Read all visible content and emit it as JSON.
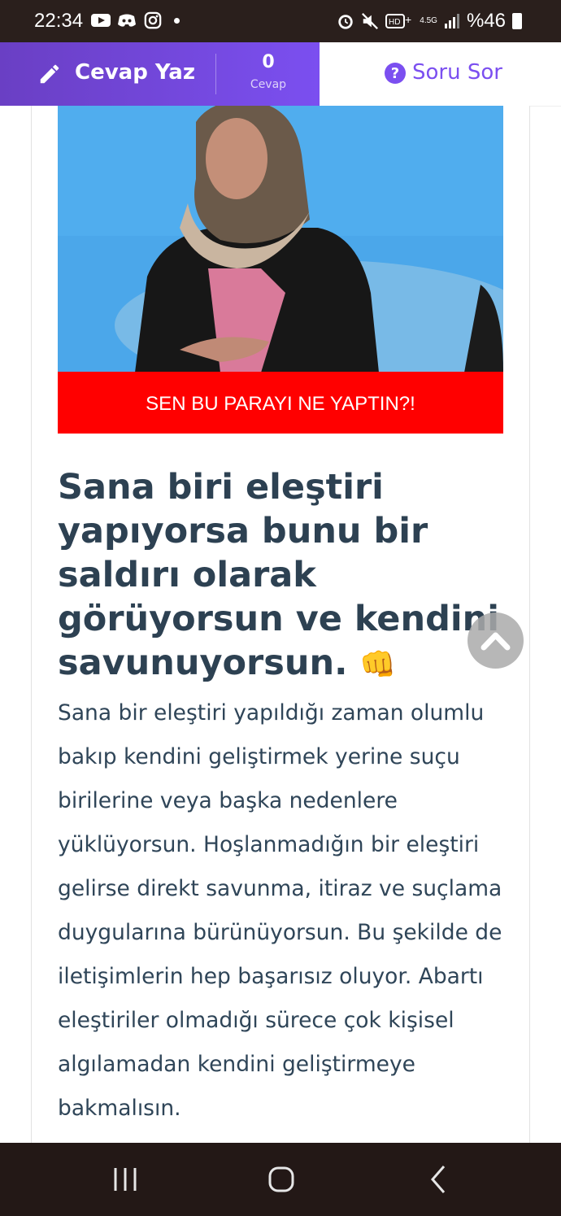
{
  "status_bar": {
    "time": "22:34",
    "network": "4.5G",
    "battery": "%46",
    "icons_left": [
      "youtube-icon",
      "discord-icon",
      "instagram-icon",
      "notification-dot"
    ],
    "icons_right": [
      "alarm-icon",
      "mute-icon",
      "volte-icon",
      "signal-icon",
      "battery-icon"
    ]
  },
  "header": {
    "answer_label": "Cevap Yaz",
    "answer_count": "0",
    "answer_count_label": "Cevap",
    "ask_label": "Soru Sor",
    "accent": "#7b4ff0"
  },
  "article": {
    "image_caption": "SEN BU PARAYI NE YAPTIN?!",
    "headline": "Sana biri eleştiri yapıyorsa bunu bir saldırı olarak görüyorsun ve kendini savunuyorsun.",
    "headline_emoji": "👊",
    "body": "Sana bir eleştiri yapıldığı zaman olumlu bakıp kendini geliştirmek yerine suçu birilerine veya başka nedenlere yüklüyorsun. Hoşlanmadığın bir eleştiri gelirse direkt savunma, itiraz ve suçlama duygularına bürünüyorsun. Bu şekilde de iletişimlerin hep başarısız oluyor. Abartı eleştiriler olmadığı sürece çok kişisel algılamadan kendini geliştirmeye bakmalısın."
  },
  "navigation": {
    "buttons": [
      "recent-apps-icon",
      "home-icon",
      "back-icon"
    ]
  }
}
